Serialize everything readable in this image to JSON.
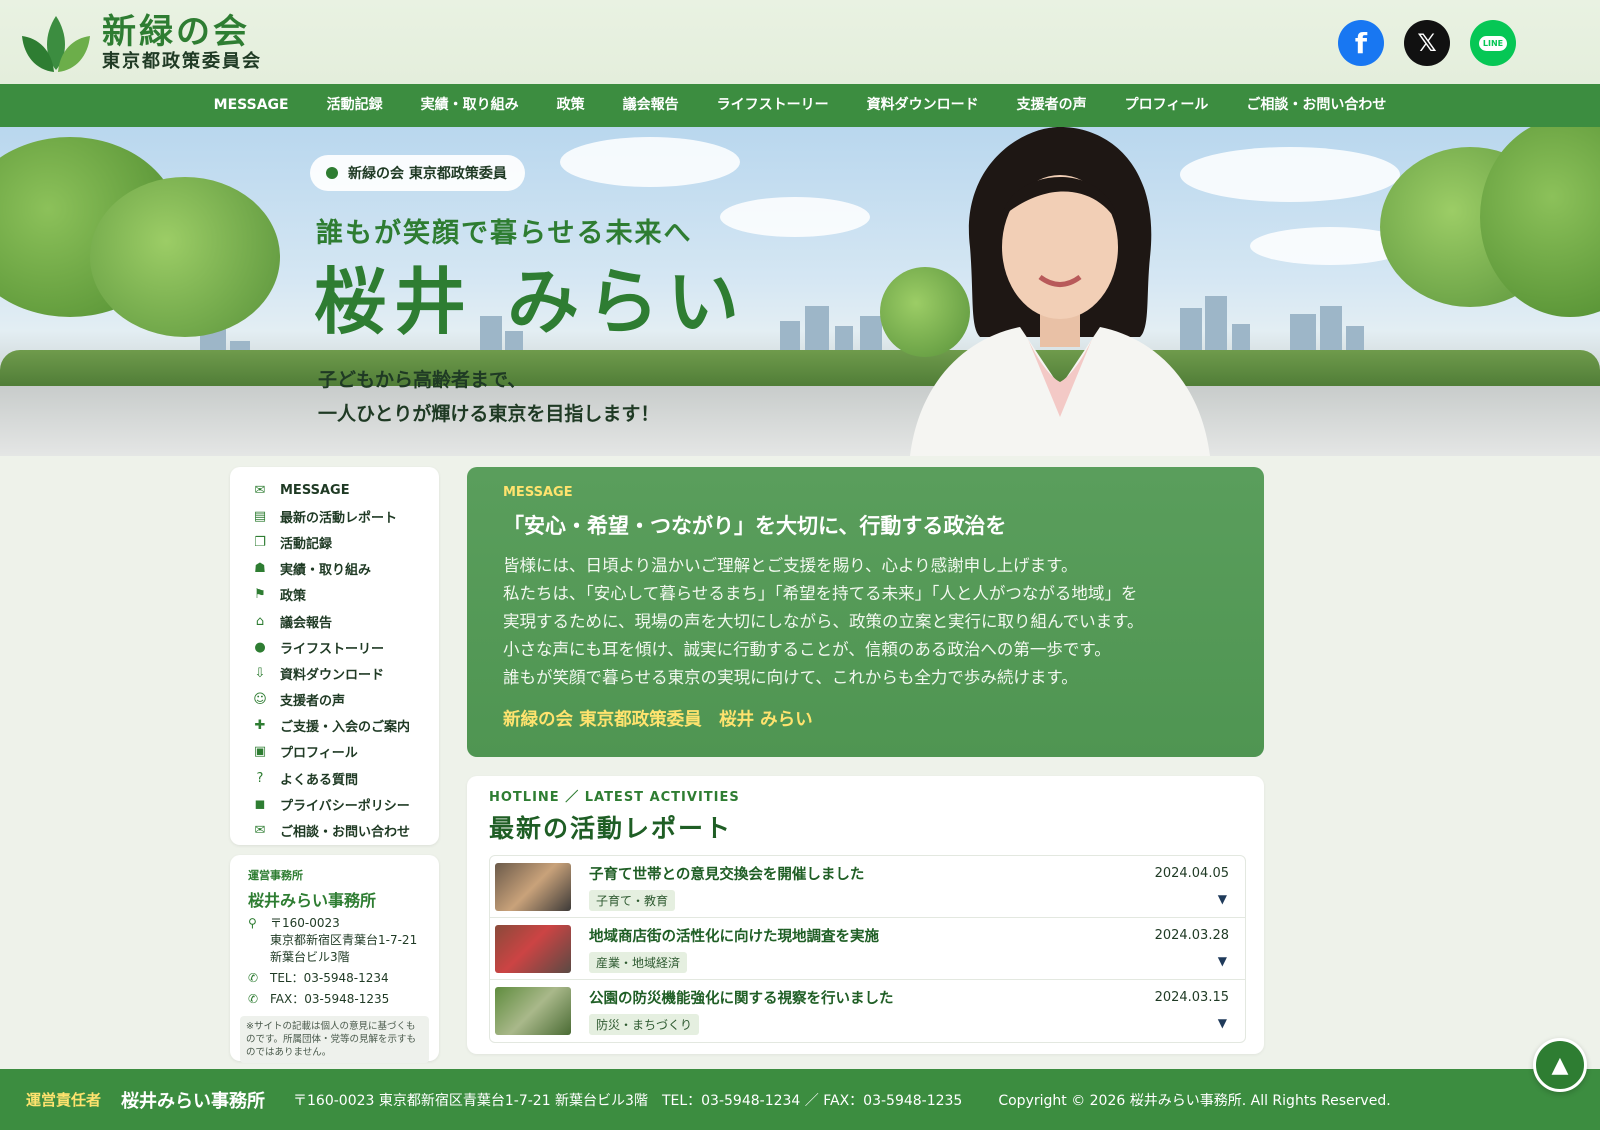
{
  "brand": {
    "title": "新緑の会",
    "subtitle": "東京都政策委員会"
  },
  "sns": [
    {
      "name": "facebook",
      "glyph": "f",
      "color": "#1877f2"
    },
    {
      "name": "x",
      "glyph": "𝕏",
      "color": "#111111"
    },
    {
      "name": "line",
      "glyph": "LINE",
      "color": "#06c755"
    }
  ],
  "nav": [
    "MESSAGE",
    "活動記録",
    "実績・取り組み",
    "政策",
    "議会報告",
    "ライフストーリー",
    "資料ダウンロード",
    "支援者の声",
    "プロフィール",
    "ご相談・お問い合わせ"
  ],
  "hero": {
    "badge": "新緑の会 東京都政策委員",
    "tagline": "誰もが笑顔で暮らせる未来へ",
    "name": "桜井 みらい",
    "lead_line1": "子どもから高齢者まで、",
    "lead_line2": "一人ひとりが輝ける東京を目指します！"
  },
  "side_menu": [
    {
      "icon": "envelope-icon",
      "glyph": "✉",
      "label": "MESSAGE"
    },
    {
      "icon": "report-icon",
      "glyph": "▤",
      "label": "最新の活動レポート"
    },
    {
      "icon": "book-icon",
      "glyph": "❐",
      "label": "活動記録"
    },
    {
      "icon": "handshake-icon",
      "glyph": "☗",
      "label": "実績・取り組み"
    },
    {
      "icon": "flag-icon",
      "glyph": "⚑",
      "label": "政策"
    },
    {
      "icon": "building-icon",
      "glyph": "⌂",
      "label": "議会報告"
    },
    {
      "icon": "person-icon",
      "glyph": "●",
      "label": "ライフストーリー"
    },
    {
      "icon": "download-icon",
      "glyph": "⇩",
      "label": "資料ダウンロード"
    },
    {
      "icon": "group-icon",
      "glyph": "☺",
      "label": "支援者の声"
    },
    {
      "icon": "supporter-icon",
      "glyph": "✚",
      "label": "ご支援・入会のご案内"
    },
    {
      "icon": "id-card-icon",
      "glyph": "▣",
      "label": "プロフィール"
    },
    {
      "icon": "question-icon",
      "glyph": "?",
      "label": "よくある質問"
    },
    {
      "icon": "lock-icon",
      "glyph": "◼",
      "label": "プライバシーポリシー"
    },
    {
      "icon": "envelope-icon",
      "glyph": "✉",
      "label": "ご相談・お問い合わせ"
    }
  ],
  "office": {
    "label": "運営事務所",
    "name": "桜井みらい事務所",
    "postal": "〒160-0023",
    "address1": "東京都新宿区青葉台1-7-21",
    "address2": "新葉台ビル3階",
    "tel": "TEL：03-5948-1234",
    "fax": "FAX：03-5948-1235",
    "note": "※サイトの記載は個人の意見に基づくものです。所属団体・党等の見解を示すものではありません。"
  },
  "message": {
    "kicker": "MESSAGE",
    "title": "「安心・希望・つながり」を大切に、行動する政治を",
    "body": [
      "皆様には、日頃より温かいご理解とご支援を賜り、心より感謝申し上げます。",
      "私たちは、「安心して暮らせるまち」「希望を持てる未来」「人と人がつながる地域」を",
      "実現するために、現場の声を大切にしながら、政策の立案と実行に取り組んでいます。",
      "小さな声にも耳を傾け、誠実に行動することが、信頼のある政治への第一歩です。",
      "誰もが笑顔で暮らせる東京の実現に向けて、これからも全力で歩み続けます。"
    ],
    "signature": "新緑の会 東京都政策委員　桜井 みらい"
  },
  "reports": {
    "kicker": "HOTLINE ／ LATEST ACTIVITIES",
    "title": "最新の活動レポート",
    "items": [
      {
        "headline": "子育て世帯との意見交換会を開催しました",
        "tag": "子育て・教育",
        "date": "2024.04.05"
      },
      {
        "headline": "地域商店街の活性化に向けた現地調査を実施",
        "tag": "産業・地域経済",
        "date": "2024.03.28"
      },
      {
        "headline": "公園の防災機能強化に関する視察を行いました",
        "tag": "防災・まちづくり",
        "date": "2024.03.15"
      }
    ]
  },
  "footer": {
    "label": "運営責任者",
    "name": "桜井みらい事務所",
    "address": "〒160-0023 東京都新宿区青葉台1-7-21 新葉台ビル3階　TEL：03-5948-1234 ／ FAX：03-5948-1235",
    "copyright": "Copyright © 2026 桜井みらい事務所. All Rights Reserved."
  },
  "colors": {
    "primary": "#3c8d40",
    "accent_yellow": "#ffe36e",
    "dark_green": "#1f5e25"
  }
}
